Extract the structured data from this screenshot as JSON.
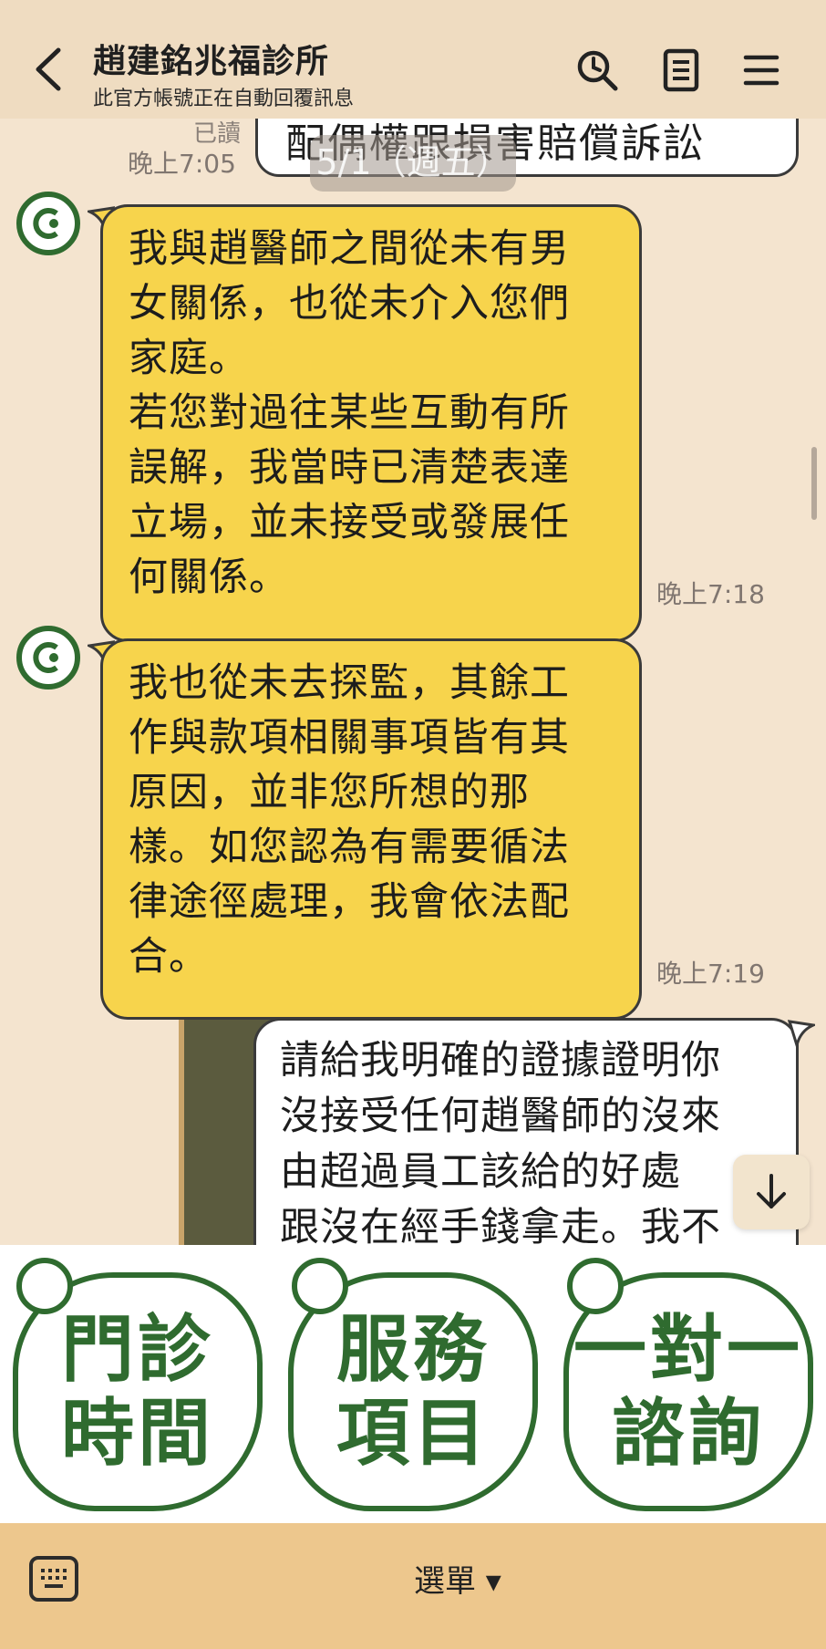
{
  "header": {
    "title": "趙建銘兆福診所",
    "subtitle": "此官方帳號正在自動回覆訊息",
    "icons": [
      "back-icon",
      "search-icon",
      "notes-icon",
      "menu-icon"
    ]
  },
  "chat": {
    "date_pill": "5/1（週五）",
    "top_outgoing": {
      "text": "配偶權跟損害賠償訴訟",
      "read": "已讀",
      "time": "晚上7:05"
    },
    "incoming_1": {
      "lines": [
        "我與趙醫師之間從未有男",
        "女關係，也從未介入您們",
        "家庭。",
        "若您對過往某些互動有所",
        "誤解，我當時已清楚表達",
        "立場，並未接受或發展任",
        "何關係。"
      ],
      "time": "晚上7:18"
    },
    "incoming_2": {
      "lines": [
        "我也從未去探監，其餘工",
        "作與款項相關事項皆有其",
        "原因，並非您所想的那",
        "樣。如您認為有需要循法",
        "律途徑處理，我會依法配",
        "合。"
      ],
      "time": "晚上7:19"
    },
    "outgoing_2": {
      "lines": [
        "請給我明確的證據證明你",
        "沒接受任何趙醫師的沒來",
        "由超過員工該給的好處",
        "跟沒在經手錢拿走。我不"
      ]
    }
  },
  "rich_menu": {
    "items": [
      {
        "line1": "門診",
        "line2": "時間"
      },
      {
        "line1": "服務",
        "line2": "項目"
      },
      {
        "line1": "一對一",
        "line2": "諮詢"
      }
    ]
  },
  "bottom_bar": {
    "menu_label": "選單 ▾"
  },
  "colors": {
    "accent_green": "#2f6b2f",
    "bubble_yellow": "#f7d44c",
    "header_bg": "#efdcc1",
    "bottom_bar_bg": "#edc78d"
  }
}
